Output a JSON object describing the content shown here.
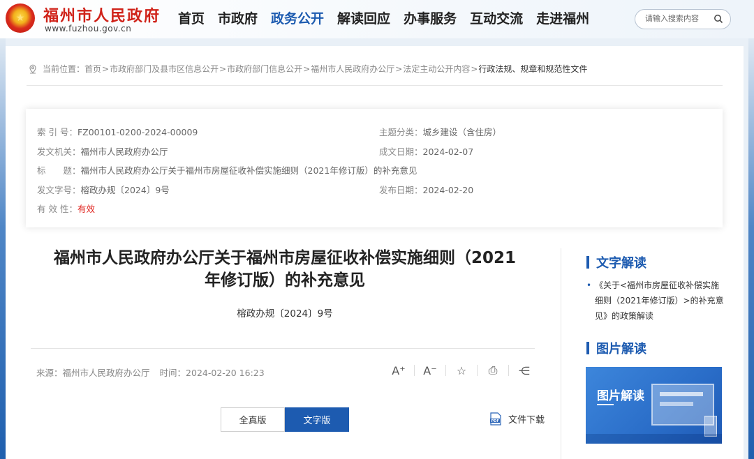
{
  "header": {
    "emblem_glyph": "★",
    "site_name": "福州市人民政府",
    "site_url": "www.fuzhou.gov.cn",
    "nav": [
      "首页",
      "市政府",
      "政务公开",
      "解读回应",
      "办事服务",
      "互动交流",
      "走进福州"
    ],
    "active_nav": "政务公开",
    "search_placeholder": "请输入搜索内容"
  },
  "breadcrumb": {
    "label": "当前位置：",
    "items": [
      "首页",
      "市政府部门及县市区信息公开",
      "市政府部门信息公开",
      "福州市人民政府办公厅",
      "法定主动公开内容",
      "行政法规、规章和规范性文件"
    ],
    "separator": ">"
  },
  "meta": {
    "index_label": "索 引 号：",
    "index_value": "FZ00101-0200-2024-00009",
    "category_label": "主题分类：",
    "category_value": "城乡建设（含住房）",
    "issuer_label": "发文机关：",
    "issuer_value": "福州市人民政府办公厅",
    "created_label": "成文日期：",
    "created_value": "2024-02-07",
    "title_label": "标　　题：",
    "title_value": "福州市人民政府办公厅关于福州市房屋征收补偿实施细则（2021年修订版）的补充意见",
    "docno_label": "发文字号：",
    "docno_value": "榕政办规〔2024〕9号",
    "published_label": "发布日期：",
    "published_value": "2024-02-20",
    "validity_label": "有 效 性：",
    "validity_value": "有效"
  },
  "document": {
    "title_line1": "福州市人民政府办公厅关于福州市房屋征收补偿实施细则（2021",
    "title_line2": "年修订版）的补充意见",
    "number": "榕政办规〔2024〕9号",
    "source_label": "来源：",
    "source_value": "福州市人民政府办公厅",
    "time_label": "时间：",
    "time_value": "2024-02-20 16:23"
  },
  "tools": {
    "font_larger": "A⁺",
    "font_smaller": "A⁻",
    "favorite": "☆",
    "print": "⎙",
    "share": "⋲"
  },
  "view_toggle": {
    "full": "全真版",
    "text": "文字版",
    "selected": "文字版"
  },
  "download": {
    "label": "文件下载",
    "icon_text": "PDF"
  },
  "sidebar": {
    "text_interpretation": "文字解读",
    "text_item_bullet": "•",
    "text_item": "《关于<福州市房屋征收补偿实施细则（2021年修订版）>的补充意见》的政策解读",
    "pic_interpretation": "图片解读",
    "pic_card_label": "图片解读"
  },
  "colors": {
    "brand_red": "#d0231a",
    "accent_blue": "#1d5bb0",
    "valid_red": "#e0201b"
  }
}
